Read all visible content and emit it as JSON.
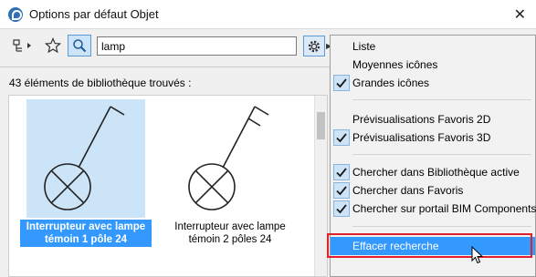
{
  "window": {
    "title": "Options par défaut Objet"
  },
  "toolbar": {
    "search_value": "lamp"
  },
  "results": {
    "count_label": "43 éléments de bibliothèque trouvés :",
    "items": [
      {
        "name_line1": "Interrupteur avec lampe",
        "name_line2": "témoin 1 pôle 24",
        "selected": true
      },
      {
        "name_line1": "Interrupteur avec lampe",
        "name_line2": "témoin 2 pôles 24",
        "selected": false
      }
    ]
  },
  "menu": {
    "items": [
      {
        "label": "Liste",
        "checked": false
      },
      {
        "label": "Moyennes icônes",
        "checked": false
      },
      {
        "label": "Grandes icônes",
        "checked": true
      },
      {
        "label": "Prévisualisations Favoris 2D",
        "checked": false
      },
      {
        "label": "Prévisualisations Favoris 3D",
        "checked": true
      },
      {
        "label": "Chercher dans Bibliothèque active",
        "checked": true
      },
      {
        "label": "Chercher dans Favoris",
        "checked": true
      },
      {
        "label": "Chercher sur portail BIM Components",
        "checked": true
      },
      {
        "label": "Effacer recherche",
        "checked": false,
        "highlighted": true
      }
    ]
  },
  "colors": {
    "accent": "#3399ff",
    "selection_bg": "#cce4f7",
    "annotation_red": "#e0202a"
  },
  "icons": [
    "app-icon",
    "close-icon",
    "object-tree-icon",
    "star-icon",
    "search-icon",
    "gear-icon",
    "checkmark-icon",
    "mouse-cursor-icon"
  ]
}
